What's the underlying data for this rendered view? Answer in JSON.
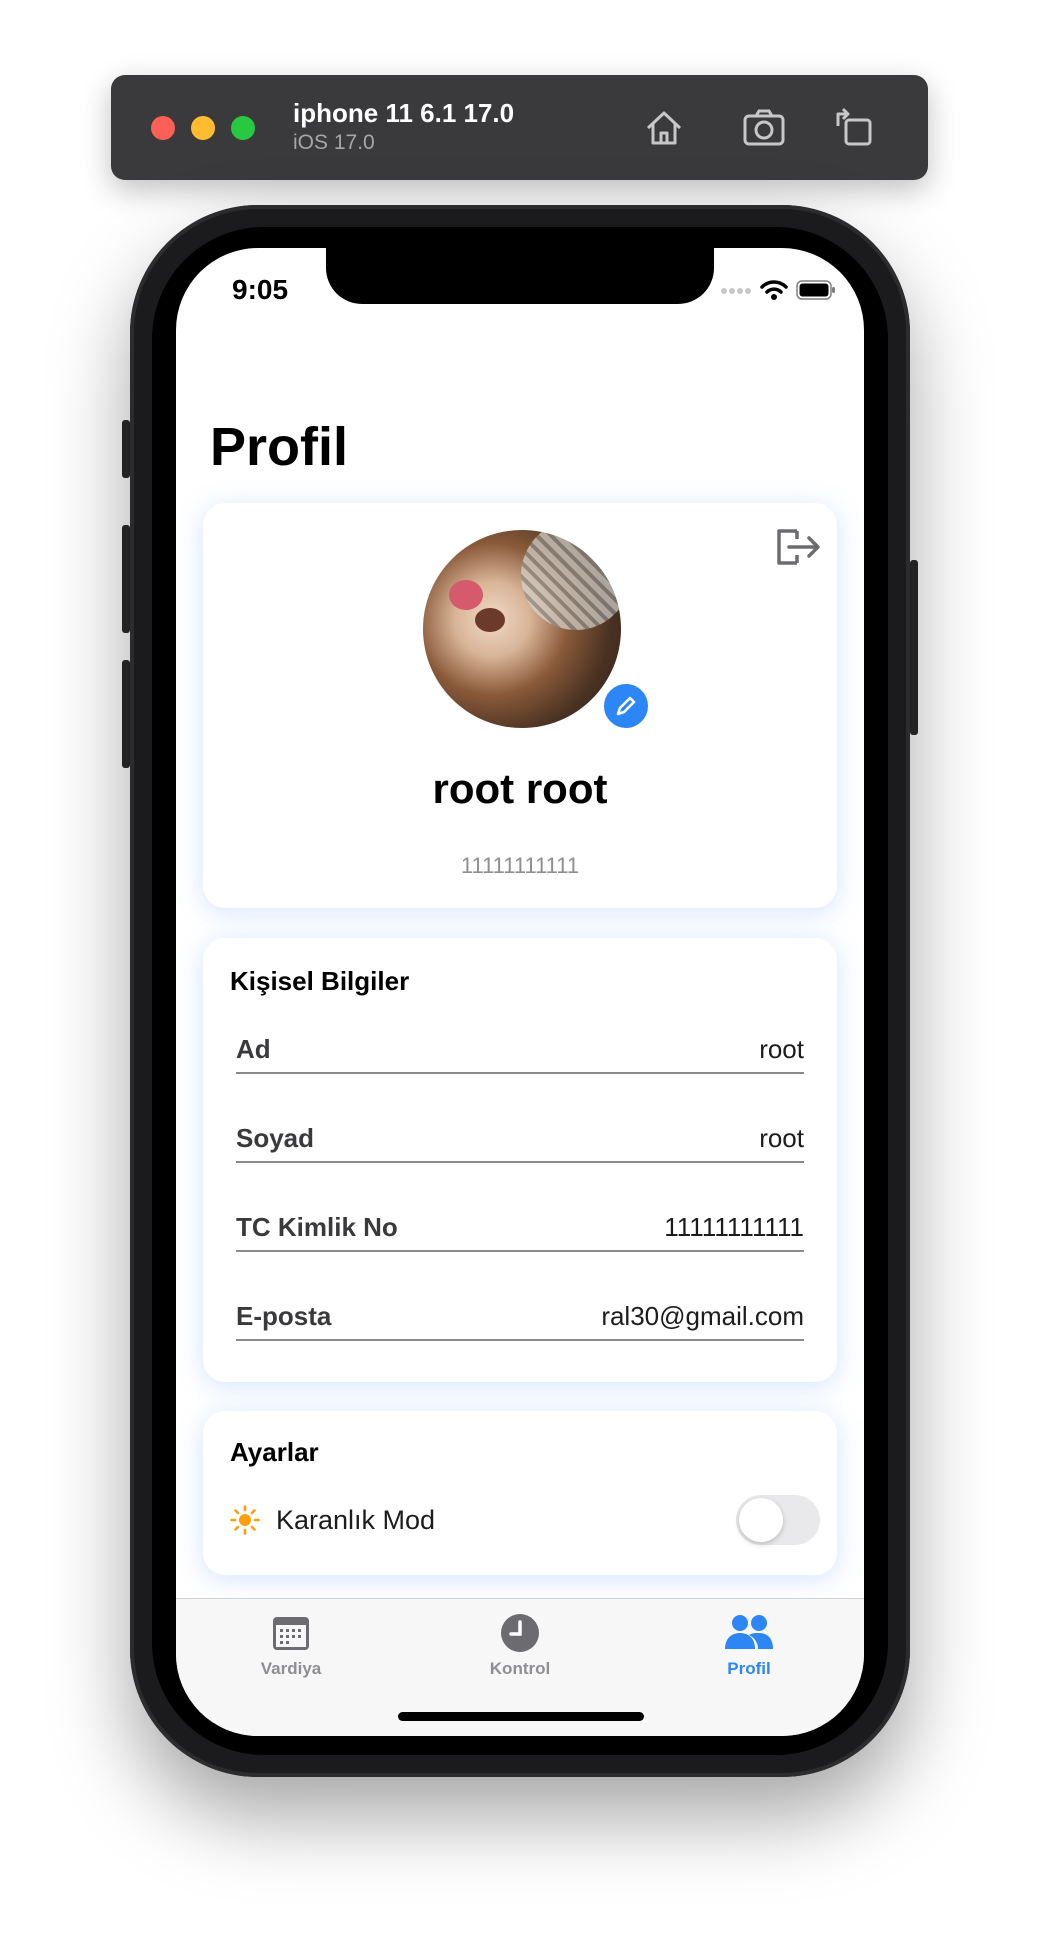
{
  "simulator": {
    "device_name": "iphone 11 6.1 17.0",
    "os_version": "iOS 17.0",
    "icons": [
      "home-icon",
      "screenshot-icon",
      "rotate-icon"
    ]
  },
  "status_bar": {
    "time": "9:05"
  },
  "page": {
    "title": "Profil"
  },
  "profile": {
    "name": "root root",
    "id_number": "11111111111",
    "accent_color": "#2d86f5"
  },
  "personal_info": {
    "title": "Kişisel Bilgiler",
    "rows": [
      {
        "label": "Ad",
        "value": "root"
      },
      {
        "label": "Soyad",
        "value": "root"
      },
      {
        "label": "TC Kimlik No",
        "value": "11111111111"
      },
      {
        "label": "E-posta",
        "value": "ral30@gmail.com"
      }
    ]
  },
  "settings": {
    "title": "Ayarlar",
    "dark_mode_label": "Karanlık Mod",
    "dark_mode_on": false,
    "icon": "sun-icon"
  },
  "tabbar": {
    "tabs": [
      {
        "label": "Vardiya",
        "icon": "calendar-icon",
        "active": false
      },
      {
        "label": "Kontrol",
        "icon": "clock-icon",
        "active": false
      },
      {
        "label": "Profil",
        "icon": "people-icon",
        "active": true
      }
    ]
  }
}
